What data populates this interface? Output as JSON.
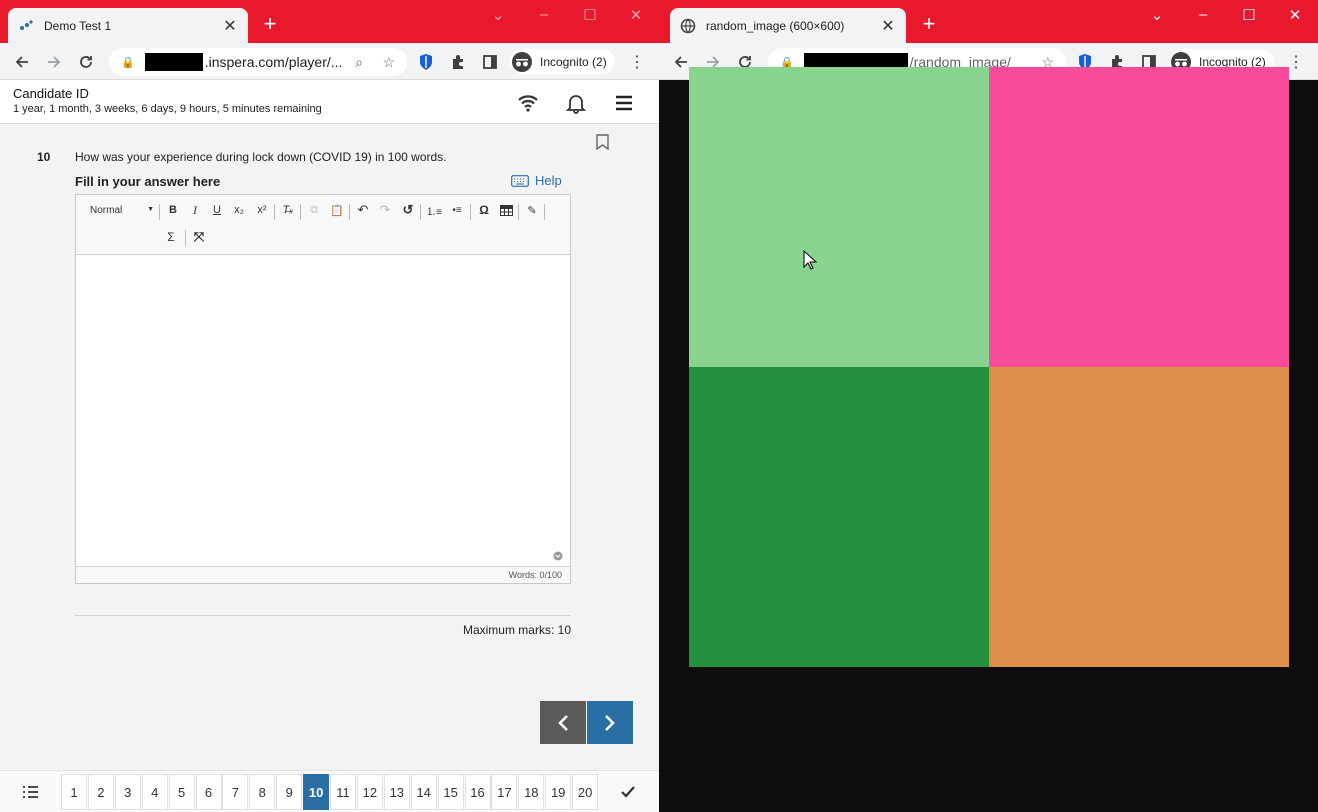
{
  "left_window": {
    "tab_title": "Demo Test 1",
    "address": ".inspera.com/player/...",
    "incognito": "Incognito (2)"
  },
  "right_window": {
    "tab_title": "random_image (600×600)",
    "address": "/random_image/",
    "incognito": "Incognito (2)",
    "quadrant_colors": [
      "#88d48e",
      "#fa4b9a",
      "#23913d",
      "#dd8f49"
    ]
  },
  "header": {
    "candidate": "Candidate ID",
    "remaining": "1 year, 1 month, 3 weeks, 6 days, 9 hours, 5 minutes remaining"
  },
  "question": {
    "number": "10",
    "text": "How was your experience during lock down (COVID 19) in 100 words.",
    "fill_label": "Fill in your answer here",
    "help": "Help",
    "format": "Normal",
    "words": "Words: 0/100",
    "max_marks": "Maximum marks: 10"
  },
  "pages": [
    "1",
    "2",
    "3",
    "4",
    "5",
    "6",
    "7",
    "8",
    "9",
    "10",
    "11",
    "12",
    "13",
    "14",
    "15",
    "16",
    "17",
    "18",
    "19",
    "20"
  ],
  "active_page": "10",
  "colors": {
    "brand_red": "#e8192c",
    "accent_blue": "#2a6ea6"
  }
}
